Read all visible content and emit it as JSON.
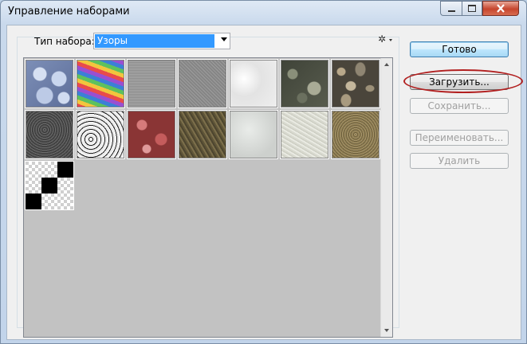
{
  "window": {
    "title": "Управление наборами"
  },
  "preset": {
    "type_label": "Тип набора:",
    "selected": "Узоры"
  },
  "buttons": {
    "done": "Готово",
    "load": "Загрузить...",
    "save": "Сохранить...",
    "rename": "Переименовать...",
    "delete": "Удалить"
  },
  "patterns": [
    "blue-bubbles",
    "rainbow",
    "gray-fabric",
    "gray-noise",
    "white-plaster",
    "dark-granite",
    "pebbles",
    "black-granite",
    "speckled-white",
    "red-leaves",
    "brown-moss",
    "light-marble",
    "light-stone",
    "sand-gravel",
    "transparency-checker"
  ],
  "colors": {
    "highlight": "#b22020",
    "selection": "#3399ff",
    "panel": "#c2c2c2"
  }
}
